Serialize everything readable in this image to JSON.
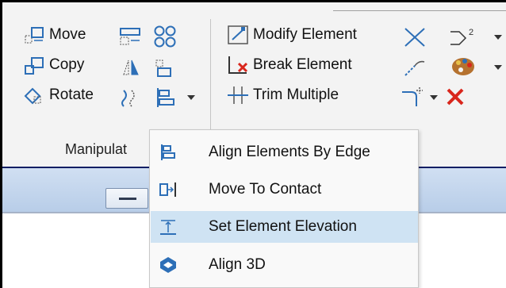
{
  "ribbon": {
    "manipulate": {
      "move_label": "Move",
      "copy_label": "Copy",
      "rotate_label": "Rotate",
      "group_label": "Manipulat"
    },
    "modify": {
      "modify_element_label": "Modify Element",
      "break_element_label": "Break Element",
      "trim_multiple_label": "Trim Multiple"
    }
  },
  "align_menu": {
    "items": [
      {
        "label": "Align Elements By Edge",
        "icon": "align-edge-icon",
        "highlighted": false
      },
      {
        "label": "Move To Contact",
        "icon": "move-to-contact-icon",
        "highlighted": false
      },
      {
        "label": "Set Element Elevation",
        "icon": "set-elevation-icon",
        "highlighted": true
      },
      {
        "label": "Align 3D",
        "icon": "align-3d-icon",
        "highlighted": false
      }
    ]
  },
  "colors": {
    "ribbon_bg": "#f3f3f3",
    "icon_blue": "#2d6fb7",
    "menu_highlight": "#cfe3f3",
    "delete_red": "#d9261c",
    "palette_brown": "#b5722f"
  }
}
